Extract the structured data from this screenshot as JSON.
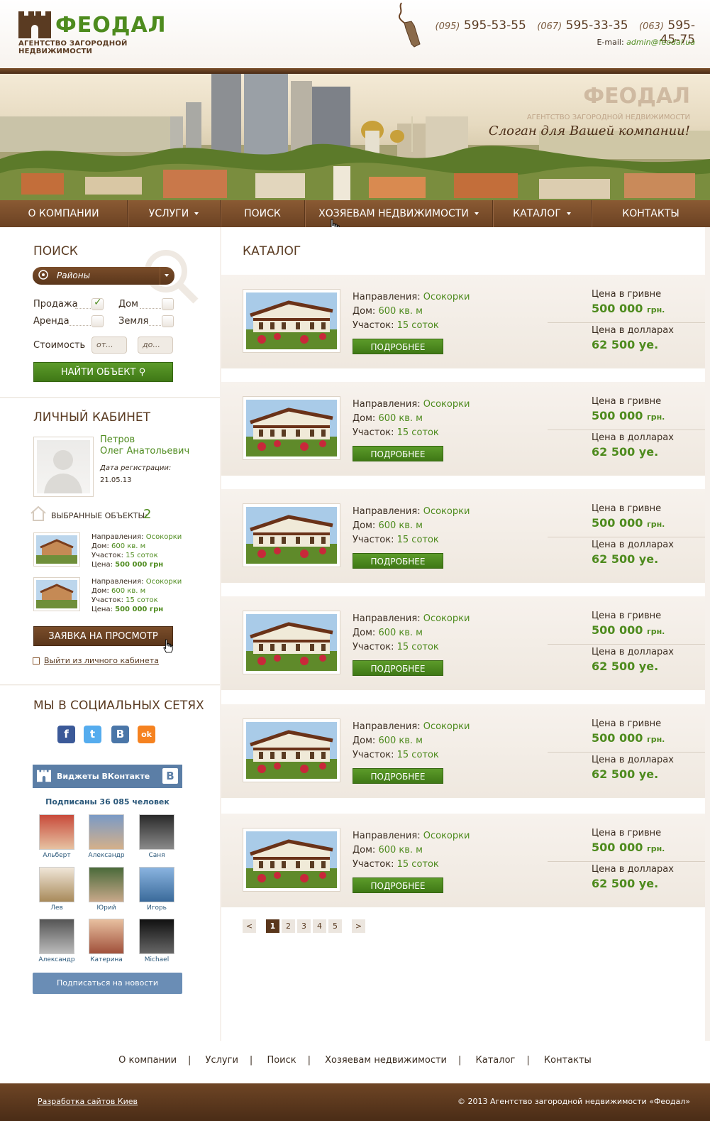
{
  "brand": {
    "name": "ФЕОДАЛ",
    "subtitle": "АГЕНТСТВО ЗАГОРОДНОЙ НЕДВИЖИМОСТИ"
  },
  "contacts": {
    "phones": [
      {
        "code": "(095)",
        "number": "595-53-55"
      },
      {
        "code": "(067)",
        "number": "595-33-35"
      },
      {
        "code": "(063)",
        "number": "595-45-75"
      }
    ],
    "email_label": "E-mail:",
    "email": "admin@feodal.ua"
  },
  "banner": {
    "slogan": "Слоган для Вашей компании!",
    "logo_name": "ФЕОДАЛ",
    "logo_sub": "АГЕНТСТВО ЗАГОРОДНОЙ НЕДВИЖИМОСТИ"
  },
  "nav": [
    {
      "label": "О компании"
    },
    {
      "label": "Услуги"
    },
    {
      "label": "Поиск"
    },
    {
      "label": "Хозяевам недвижимости"
    },
    {
      "label": "Каталог"
    },
    {
      "label": "Контакты"
    }
  ],
  "search": {
    "title": "ПОИСК",
    "district_placeholder": "Районы",
    "sale": "Продажа",
    "rent": "Аренда",
    "house": "Дом",
    "land": "Земля",
    "sale_checked": true,
    "cost": "Стоимость",
    "from": "от...",
    "to": "до...",
    "find_button": "НАЙТИ ОБЪЕКТ"
  },
  "cabinet": {
    "title": "ЛИЧНЫЙ КАБИНЕТ",
    "surname": "Петров",
    "name": "Олег Анатольевич",
    "reg_label": "Дата регистрации:",
    "reg_date": "21.05.13",
    "fav_label": "ВЫБРАННЫЕ ОБЪЕКТЫ:",
    "fav_count": "2",
    "favorites": [
      {
        "dir_label": "Направления:",
        "dir": "Осокорки",
        "house_label": "Дом:",
        "house": "600 кв. м",
        "plot_label": "Участок:",
        "plot": "15 соток",
        "price_label": "Цена:",
        "price": "500 000 грн"
      },
      {
        "dir_label": "Направления:",
        "dir": "Осокорки",
        "house_label": "Дом:",
        "house": "600 кв. м",
        "plot_label": "Участок:",
        "plot": "15 соток",
        "price_label": "Цена:",
        "price": "500 000 грн"
      }
    ],
    "request_button": "ЗАЯВКА НА ПРОСМОТР",
    "logout": "Выйти из личного кабинета"
  },
  "social": {
    "title": "МЫ В СОЦИАЛЬНЫХ СЕТЯХ",
    "icons": [
      "f",
      "t",
      "B",
      "ok"
    ],
    "colors": {
      "facebook": "#3b5998",
      "twitter": "#55acee",
      "vk": "#4a76a8",
      "ok": "#f58220"
    },
    "widget_title": "Виджеты ВКонтакте",
    "widget_letter": "B",
    "subscribers": "Подписаны 36 085 человек",
    "people": [
      "Альберт",
      "Александр",
      "Саня",
      "Лев",
      "Юрий",
      "Игорь",
      "Александр",
      "Катерина",
      "Michael"
    ],
    "subscribe_button": "Подписаться на новости"
  },
  "catalog": {
    "title": "КАТАЛОГ",
    "items": [
      {
        "dir_label": "Направления:",
        "dir": "Осокорки",
        "house_label": "Дом:",
        "house": "600 кв. м",
        "plot_label": "Участок:",
        "plot": "15 соток",
        "more": "ПОДРОБНЕЕ",
        "uah_label": "Цена в гривне",
        "uah": "500 000",
        "uah_unit": "грн.",
        "usd_label": "Цена в долларах",
        "usd": "62 500 уе."
      },
      {
        "dir_label": "Направления:",
        "dir": "Осокорки",
        "house_label": "Дом:",
        "house": "600 кв. м",
        "plot_label": "Участок:",
        "plot": "15 соток",
        "more": "ПОДРОБНЕЕ",
        "uah_label": "Цена в гривне",
        "uah": "500 000",
        "uah_unit": "грн.",
        "usd_label": "Цена в долларах",
        "usd": "62 500 уе."
      },
      {
        "dir_label": "Направления:",
        "dir": "Осокорки",
        "house_label": "Дом:",
        "house": "600 кв. м",
        "plot_label": "Участок:",
        "plot": "15 соток",
        "more": "ПОДРОБНЕЕ",
        "uah_label": "Цена в гривне",
        "uah": "500 000",
        "uah_unit": "грн.",
        "usd_label": "Цена в долларах",
        "usd": "62 500 уе."
      },
      {
        "dir_label": "Направления:",
        "dir": "Осокорки",
        "house_label": "Дом:",
        "house": "600 кв. м",
        "plot_label": "Участок:",
        "plot": "15 соток",
        "more": "ПОДРОБНЕЕ",
        "uah_label": "Цена в гривне",
        "uah": "500 000",
        "uah_unit": "грн.",
        "usd_label": "Цена в долларах",
        "usd": "62 500 уе."
      },
      {
        "dir_label": "Направления:",
        "dir": "Осокорки",
        "house_label": "Дом:",
        "house": "600 кв. м",
        "plot_label": "Участок:",
        "plot": "15 соток",
        "more": "ПОДРОБНЕЕ",
        "uah_label": "Цена в гривне",
        "uah": "500 000",
        "uah_unit": "грн.",
        "usd_label": "Цена в долларах",
        "usd": "62 500 уе."
      },
      {
        "dir_label": "Направления:",
        "dir": "Осокорки",
        "house_label": "Дом:",
        "house": "600 кв. м",
        "plot_label": "Участок:",
        "plot": "15 соток",
        "more": "ПОДРОБНЕЕ",
        "uah_label": "Цена в гривне",
        "uah": "500 000",
        "uah_unit": "грн.",
        "usd_label": "Цена в долларах",
        "usd": "62 500 уе."
      }
    ],
    "pager": {
      "prev": "<",
      "pages": [
        "1",
        "2",
        "3",
        "4",
        "5"
      ],
      "current": "1",
      "next": ">"
    }
  },
  "footer": {
    "links": [
      "О компании",
      "Услуги",
      "Поиск",
      "Хозяевам недвижимости",
      "Каталог",
      "Контакты"
    ],
    "separator": "|",
    "dev": "Разработка сайтов Киев",
    "copyright": "© 2013 Агентство загородной недвижимости «Феодал»"
  }
}
